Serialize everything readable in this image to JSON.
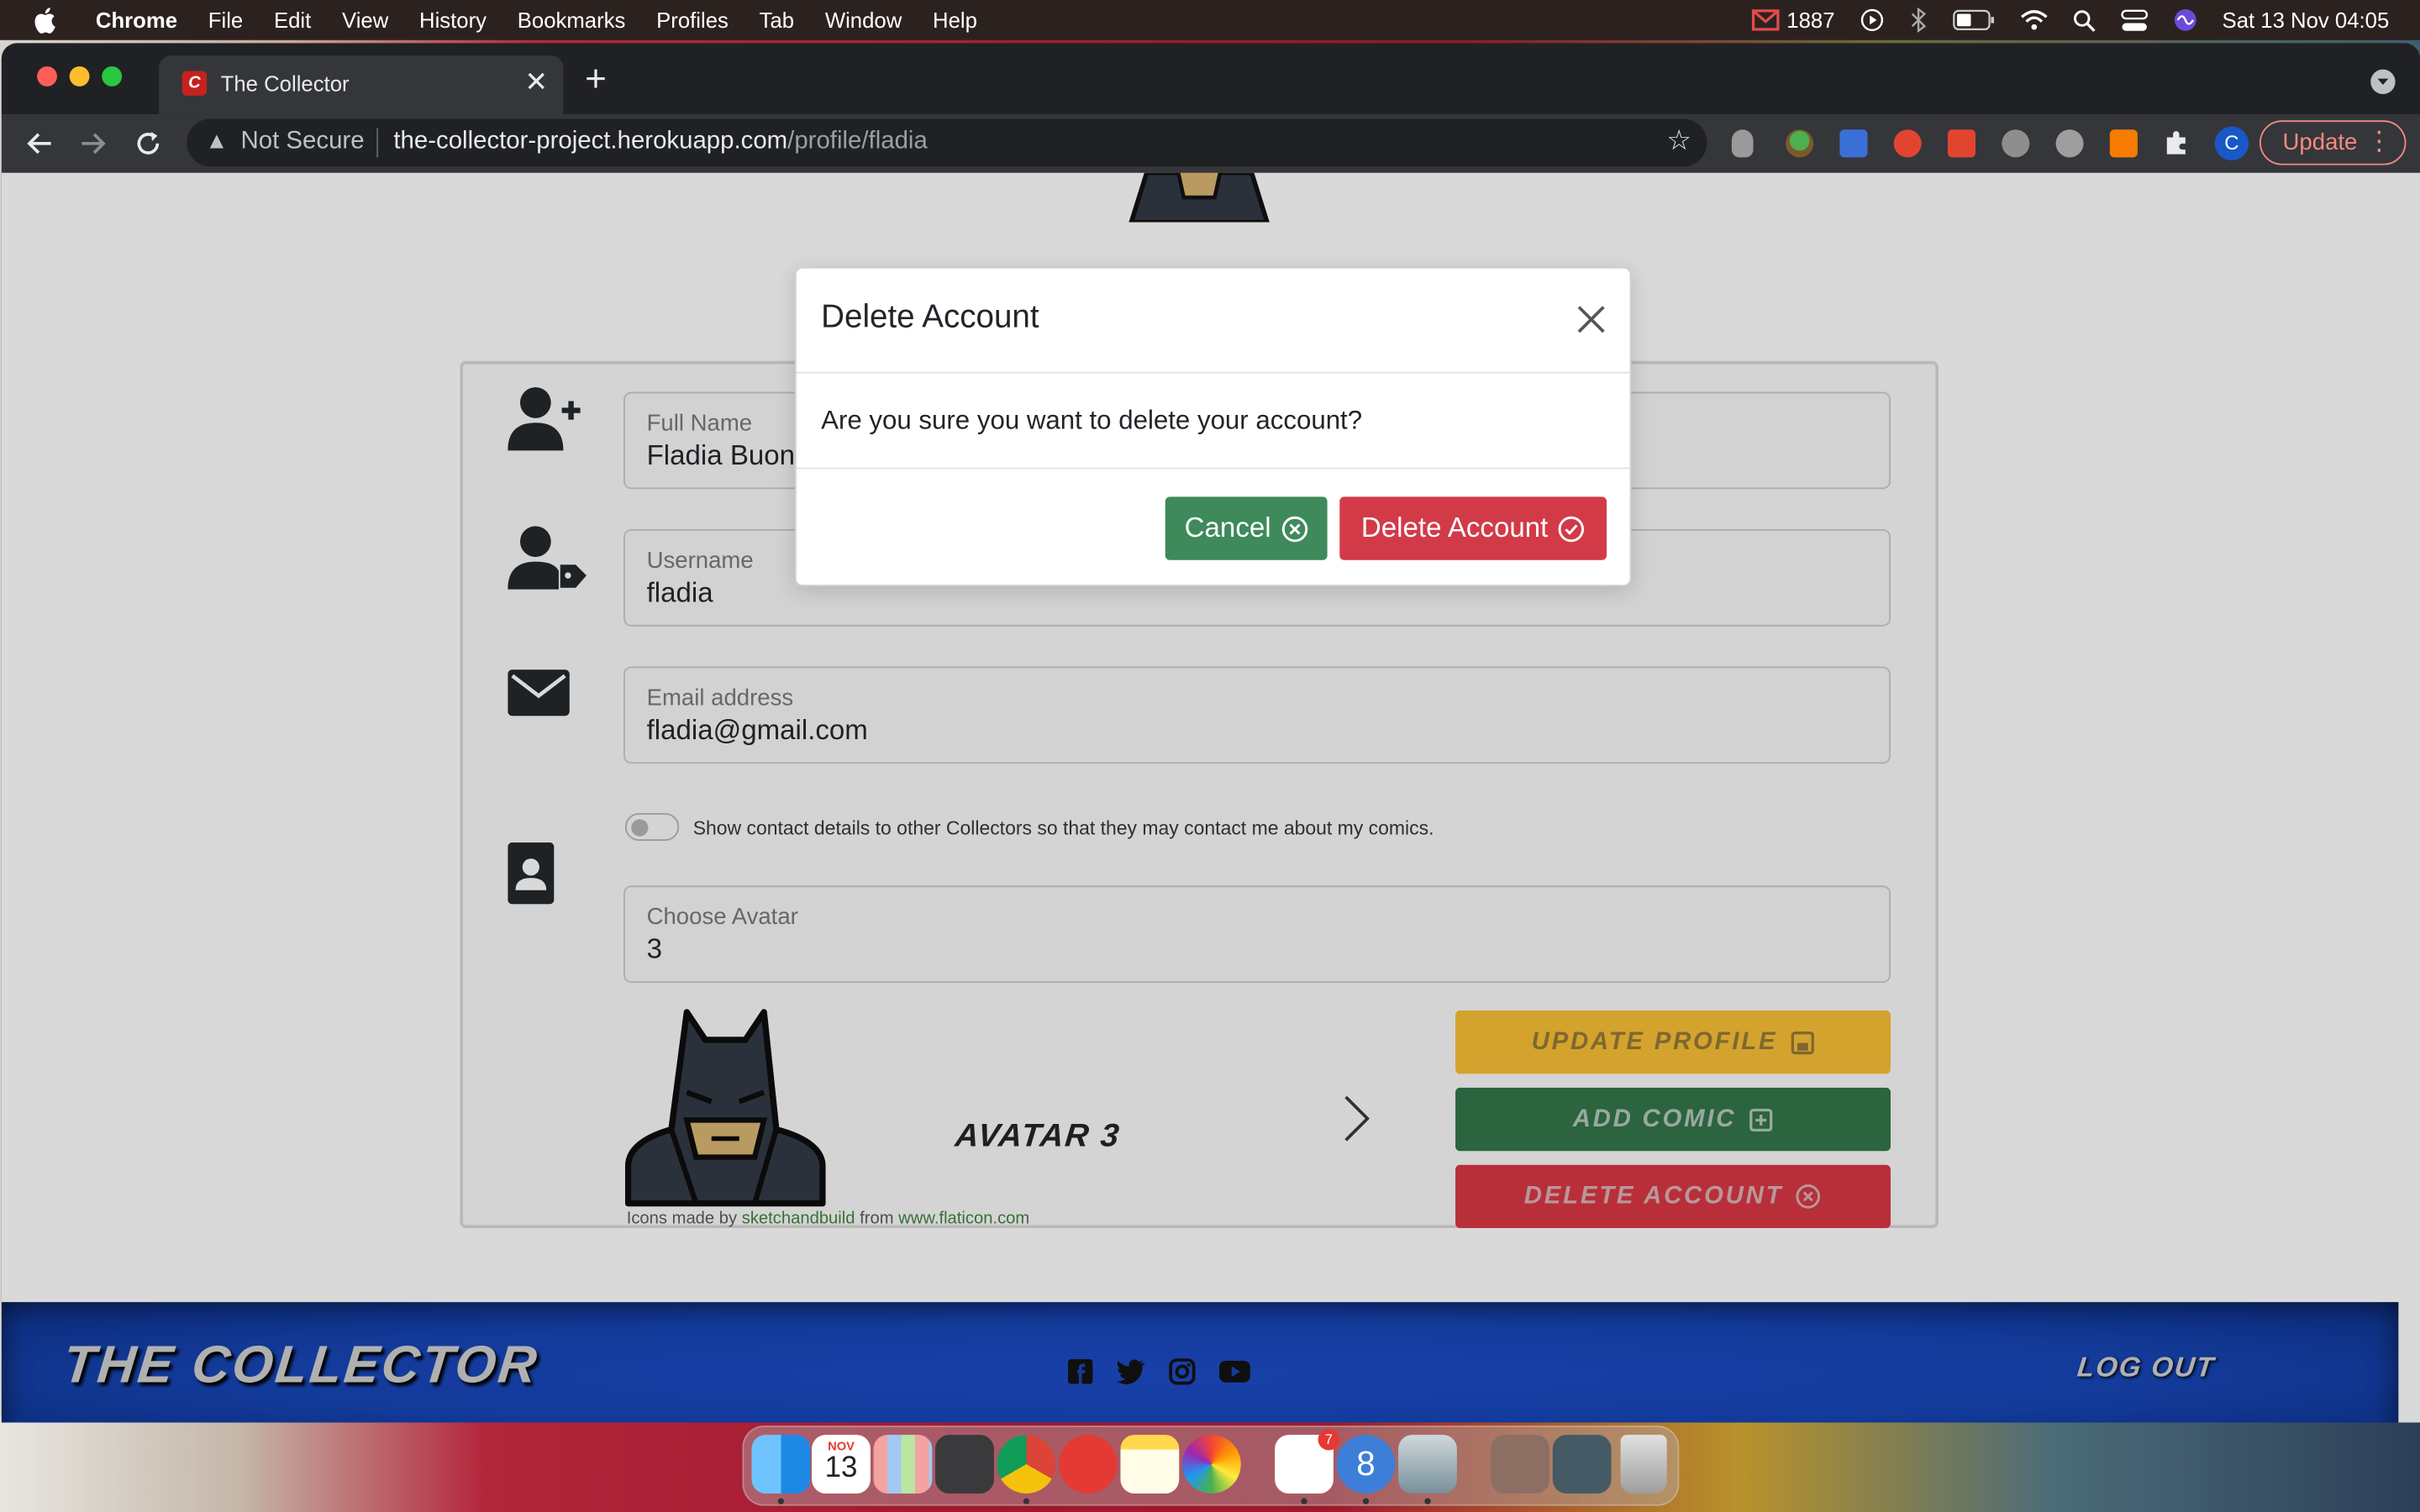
{
  "menubar": {
    "app": "Chrome",
    "menus": [
      "File",
      "Edit",
      "View",
      "History",
      "Bookmarks",
      "Profiles",
      "Tab",
      "Window",
      "Help"
    ],
    "mail_count": "1887",
    "datetime": "Sat 13 Nov  04:05"
  },
  "browser": {
    "tab_title": "The Collector",
    "tab_favicon_letter": "C",
    "not_secure": "Not Secure",
    "url_host": "the-collector-project.herokuapp.com",
    "url_path": "/profile/fladia",
    "profile_letter": "C",
    "update_label": "Update"
  },
  "profile_form": {
    "full_name_label": "Full Name",
    "full_name_value": "Fladia Buong",
    "username_label": "Username",
    "username_value": "fladia",
    "email_label": "Email address",
    "email_value": "fladia@gmail.com",
    "contact_toggle_label": "Show contact details to other Collectors so that they may contact me about my comics.",
    "contact_toggle_on": false,
    "avatar_label": "Choose Avatar",
    "avatar_value": "3",
    "avatar_name": "AVATAR 3",
    "credit_prefix": "Icons made by ",
    "credit_author": "sketchandbuild",
    "credit_middle": " from ",
    "credit_site": "www.flaticon.com"
  },
  "actions": {
    "update_profile": "UPDATE PROFILE",
    "add_comic": "ADD COMIC",
    "delete_account": "DELETE ACCOUNT"
  },
  "footer": {
    "brand": "THE COLLECTOR",
    "logout": "LOG OUT",
    "social_icons": [
      "facebook-icon",
      "twitter-icon",
      "instagram-icon",
      "youtube-icon"
    ]
  },
  "modal": {
    "title": "Delete Account",
    "message": "Are you sure you want to delete your account?",
    "cancel_label": "Cancel",
    "confirm_label": "Delete Account"
  },
  "dock": {
    "calendar_month": "NOV",
    "calendar_day": "13",
    "slack_badge": "7",
    "app_badge": "8"
  },
  "colors": {
    "update_btn": "#e6b132",
    "add_btn": "#2f6d45",
    "delete_btn": "#c8343f",
    "modal_cancel": "#3e8a5b",
    "modal_confirm": "#d23a48",
    "footer_blue": "#1540a8"
  }
}
